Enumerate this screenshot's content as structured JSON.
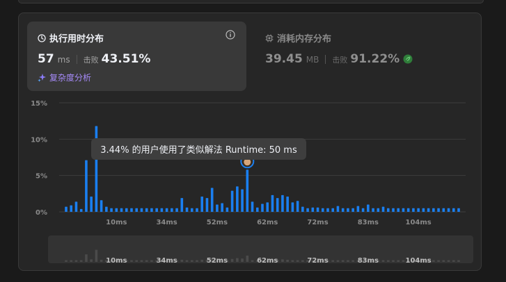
{
  "runtime_card": {
    "title": "执行用时分布",
    "value": "57",
    "unit": "ms",
    "beat_label": "击败",
    "beat_value": "43.51%",
    "complexity_link": "复杂度分析"
  },
  "memory_card": {
    "title": "消耗内存分布",
    "value": "39.45",
    "unit": "MB",
    "beat_label": "击败",
    "beat_value": "91.22%"
  },
  "tooltip": {
    "text": "3.44% 的用户使用了类似解法 Runtime: 50 ms"
  },
  "colors": {
    "bar": "#1a7ff0",
    "grid": "#3e3e3e",
    "mini_bar": "#4a4a4a",
    "accent": "#a78bfa"
  },
  "chart_data": {
    "type": "bar",
    "y_tick_labels": [
      "0%",
      "5%",
      "10%",
      "15%"
    ],
    "y_ticks": [
      0,
      5,
      10,
      15
    ],
    "ylim": [
      0,
      15
    ],
    "x_tick_labels": [
      "10ms",
      "34ms",
      "52ms",
      "62ms",
      "72ms",
      "83ms",
      "104ms"
    ],
    "x_tick_bars": [
      10,
      20,
      30,
      40,
      50,
      60,
      70
    ],
    "values": [
      0.7,
      0.9,
      1.4,
      0.4,
      7.1,
      2.1,
      11.8,
      1.6,
      0.7,
      0.5,
      0.5,
      0.5,
      0.5,
      0.5,
      0.5,
      0.5,
      0.5,
      0.5,
      0.5,
      0.5,
      0.5,
      0.5,
      0.5,
      1.9,
      0.6,
      0.5,
      0.5,
      2.1,
      1.9,
      3.3,
      1.0,
      1.2,
      0.6,
      2.9,
      3.5,
      3.1,
      5.8,
      1.4,
      0.6,
      1.1,
      1.3,
      2.3,
      1.9,
      2.3,
      2.1,
      1.3,
      1.5,
      0.7,
      0.5,
      0.6,
      0.6,
      0.5,
      0.5,
      0.5,
      0.8,
      0.5,
      0.5,
      0.5,
      0.8,
      0.5,
      1.0,
      0.5,
      0.5,
      0.7,
      0.5,
      0.5,
      0.5,
      0.5,
      0.5,
      0.5,
      0.5,
      0.5,
      0.5,
      0.5,
      0.5,
      0.5,
      0.5,
      0.5,
      0.5
    ],
    "highlight_bar": 36,
    "mini_values": [
      0.4,
      0.4,
      0.4,
      0.4,
      1.8,
      0.6,
      2.9,
      0.5,
      0.4,
      0.4,
      0.4,
      0.4,
      0.4,
      0.4,
      0.4,
      0.4,
      0.4,
      0.4,
      0.4,
      0.4,
      0.4,
      0.4,
      0.4,
      0.5,
      0.4,
      0.4,
      0.4,
      0.5,
      0.5,
      0.8,
      0.4,
      0.4,
      0.4,
      0.7,
      0.9,
      0.8,
      1.5,
      0.4,
      0.4,
      0.4,
      0.4,
      0.6,
      0.5,
      0.6,
      0.5,
      0.4,
      0.4,
      0.4,
      0.4,
      0.4,
      0.4,
      0.4,
      0.4,
      0.4,
      0.4,
      0.4,
      0.4,
      0.4,
      0.4,
      0.4,
      0.4,
      0.4,
      0.4,
      0.4,
      0.4,
      0.4,
      0.4,
      0.4,
      0.4,
      0.4,
      0.4,
      0.4,
      0.4,
      0.4,
      0.4,
      0.4,
      0.4,
      0.4,
      0.4
    ]
  }
}
